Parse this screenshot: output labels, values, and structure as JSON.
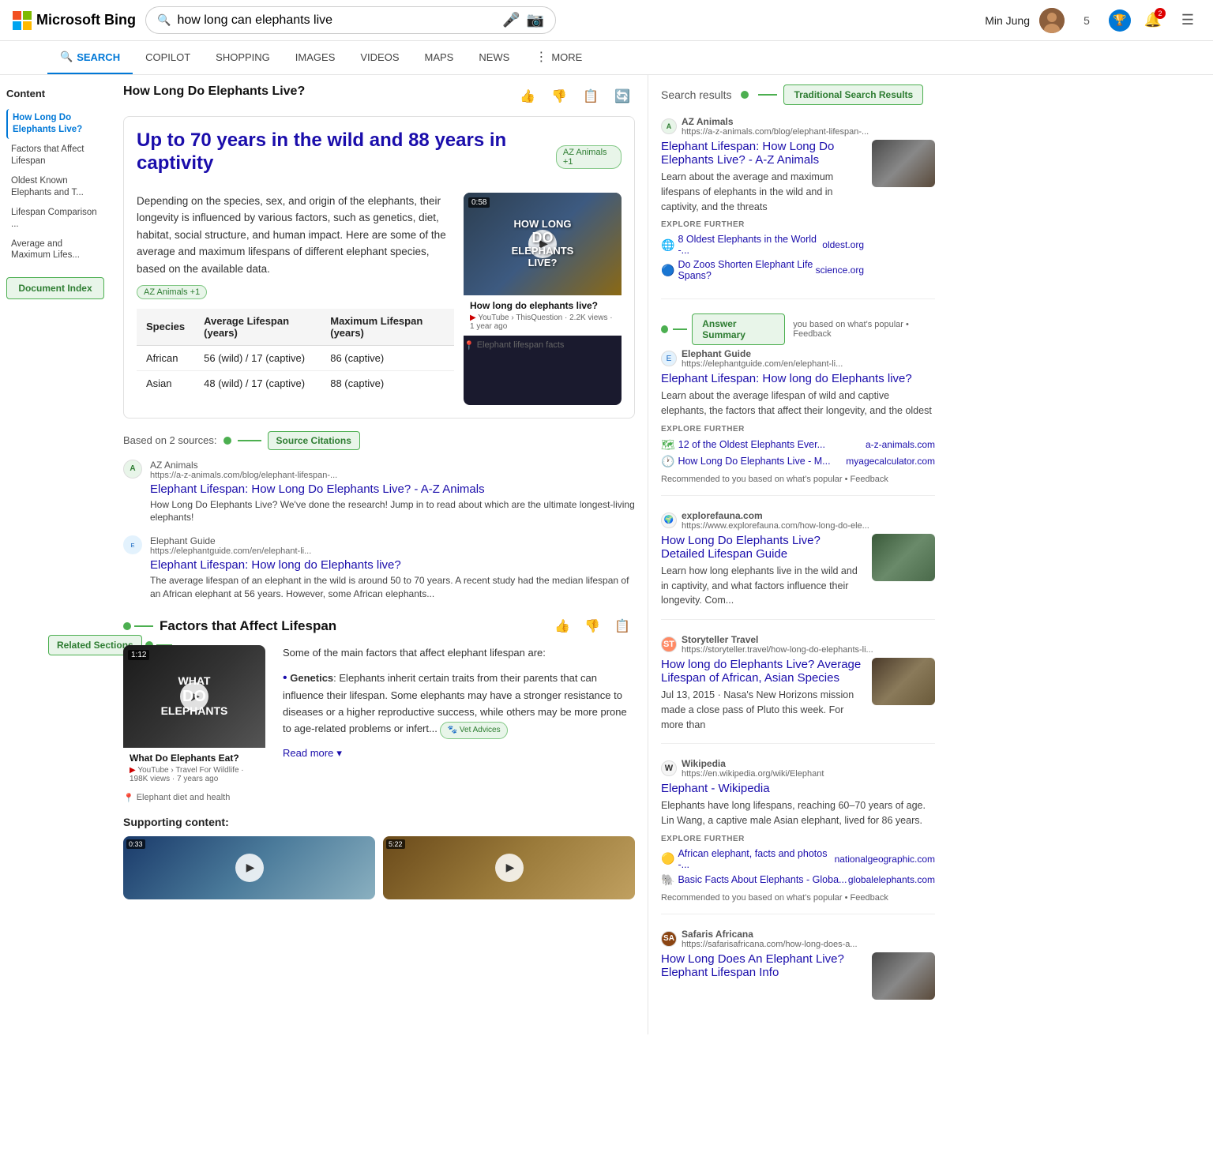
{
  "header": {
    "logo": "Microsoft Bing",
    "search_query": "how long can elephants live",
    "user_name": "Min Jung",
    "notifications_count": "2",
    "nav_tabs": [
      {
        "label": "SEARCH",
        "icon": "🔍",
        "active": true
      },
      {
        "label": "COPILOT",
        "active": false
      },
      {
        "label": "SHOPPING",
        "active": false
      },
      {
        "label": "IMAGES",
        "active": false
      },
      {
        "label": "VIDEOS",
        "active": false
      },
      {
        "label": "MAPS",
        "active": false
      },
      {
        "label": "NEWS",
        "active": false
      },
      {
        "label": "MORE",
        "active": false
      }
    ]
  },
  "sidebar": {
    "title": "Content",
    "items": [
      {
        "label": "How Long Do Elephants Live?",
        "active": true
      },
      {
        "label": "Factors that Affect Lifespan"
      },
      {
        "label": "Oldest Known Elephants and T..."
      },
      {
        "label": "Lifespan Comparison ..."
      },
      {
        "label": "Average and Maximum Lifes..."
      }
    ],
    "doc_index_label": "Document Index"
  },
  "main": {
    "page_title": "How Long Do Elephants Live?",
    "answer": {
      "headline": "Up to 70 years in the wild and 88 years in captivity",
      "source_tag": "AZ Animals +1",
      "text": "Depending on the species, sex, and origin of the elephants, their longevity is influenced by various factors, such as genetics, diet, habitat, social structure, and human impact. Here are some of the average and maximum lifespans of different elephant species, based on the available data.",
      "location_tag": "Elephant lifespan facts",
      "video": {
        "duration": "0:58",
        "title": "How long do elephants live?",
        "source": "YouTube › ThisQuestion · 2.2K views · 1 year ago",
        "text_overlay_line1": "HOW LONG",
        "text_overlay_line2": "DO",
        "text_overlay_line3": "ELEPHANTS",
        "text_overlay_line4": "LIVE?"
      },
      "table": {
        "headers": [
          "Species",
          "Average Lifespan (years)",
          "Maximum Lifespan (years)"
        ],
        "rows": [
          [
            "African",
            "56 (wild) / 17 (captive)",
            "86 (captive)"
          ],
          [
            "Asian",
            "48 (wild) / 17 (captive)",
            "88 (captive)"
          ]
        ]
      }
    },
    "sources": {
      "count_label": "Based on 2 sources:",
      "label": "Source Citations",
      "items": [
        {
          "name": "AZ Animals",
          "url": "https://a-z-animals.com/blog/elephant-lifespan-...",
          "link": "Elephant Lifespan: How Long Do Elephants Live? - A-Z Animals",
          "desc": "How Long Do Elephants Live? We've done the research! Jump in to read about which are the ultimate longest-living elephants!"
        },
        {
          "name": "Elephant Guide",
          "url": "https://elephantguide.com/en/elephant-li...",
          "link": "Elephant Lifespan: How long do Elephants live?",
          "desc": "The average lifespan of an elephant in the wild is around 50 to 70 years. A recent study had the median lifespan of an African elephant at 56 years. However, some African elephants..."
        }
      ]
    },
    "factors_section": {
      "title": "Factors that Affect Lifespan",
      "video": {
        "duration": "1:12",
        "title": "What Do Elephants Eat?",
        "source": "YouTube › Travel For Wildlife · 198K views · 7 years ago",
        "text_overlay_line1": "WHAT",
        "text_overlay_line2": "DO",
        "text_overlay_line3": "ELEPHANTS"
      },
      "location_tag": "Elephant diet and health",
      "intro": "Some of the main factors that affect elephant lifespan are:",
      "bullets": [
        {
          "term": "Genetics",
          "text": "Elephants inherit certain traits from their parents that can influence their lifespan. Some elephants may have a stronger resistance to diseases or a higher reproductive success, while others may be more prone to age-related problems or infert..."
        }
      ],
      "vet_badge": "Vet Advices",
      "read_more": "Read more",
      "supporting_content_label": "Supporting content:",
      "support_videos": [
        {
          "duration": "0:33"
        },
        {
          "duration": "5:22"
        }
      ]
    },
    "related_sections_label": "Related Sections"
  },
  "right_panel": {
    "search_results_label": "Search results",
    "traditional_tag": "Traditional Search Results",
    "answer_summary_tag": "Answer Summary",
    "results": [
      {
        "domain": "AZ Animals",
        "url": "https://a-z-animals.com/blog/elephant-lifespan-...",
        "title": "Elephant Lifespan: How Long Do Elephants Live? - A-Z Animals",
        "desc": "Learn about the average and maximum lifespans of elephants in the wild and in captivity, and the threats",
        "explore": [
          {
            "text": "8 Oldest Elephants in the World -...",
            "domain": "oldest.org"
          },
          {
            "text": "Do Zoos Shorten Elephant Life Spans?",
            "domain": "science.org"
          }
        ],
        "has_thumb": true,
        "thumb_class": "thumb-elephant1"
      },
      {
        "domain": "Elephant Guide",
        "url": "https://elephantguide.com/en/elephant-li...",
        "title": "Elephant Lifespan: How long do Elephants live?",
        "desc": "Learn about the average lifespan of wild and captive elephants, the factors that affect their longevity, and the oldest",
        "explore": [
          {
            "text": "12 of the Oldest Elephants Ever...",
            "domain": "a-z-animals.com"
          },
          {
            "text": "How Long Do Elephants Live - M...",
            "domain": "myagecalculator.com"
          }
        ],
        "recommended": "Recommended to you based on what's popular • Feedback",
        "has_thumb": false
      },
      {
        "domain": "explorefauna.com",
        "url": "https://www.explorefauna.com/how-long-do-ele...",
        "title": "How Long Do Elephants Live? Detailed Lifespan Guide",
        "desc": "Learn how long elephants live in the wild and in captivity, and what factors influence their longevity. Com...",
        "has_thumb": true,
        "thumb_class": "thumb-elephant2"
      },
      {
        "domain": "Storyteller Travel",
        "url": "https://storyteller.travel/how-long-do-elephants-li...",
        "title": "How long do Elephants Live? Average Lifespan of African, Asian Species",
        "desc": "Jul 13, 2015 · Nasa's New Horizons mission made a close pass of Pluto this week. For more than",
        "has_thumb": true,
        "thumb_class": "thumb-elephant3"
      },
      {
        "domain": "Wikipedia",
        "url": "https://en.wikipedia.org/wiki/Elephant",
        "title": "Elephant - Wikipedia",
        "desc": "Elephants have long lifespans, reaching 60–70 years of age. Lin Wang, a captive male Asian elephant, lived for 86 years.",
        "explore": [
          {
            "text": "African elephant, facts and photos -...",
            "domain": "nationalgeographic.com"
          },
          {
            "text": "Basic Facts About Elephants - Globa...",
            "domain": "globalelephants.com"
          }
        ],
        "recommended": "Recommended to you based on what's popular • Feedback",
        "has_thumb": false
      },
      {
        "domain": "Safaris Africana",
        "url": "https://safarisafricana.com/how-long-does-a...",
        "title": "How Long Does An Elephant Live? Elephant Lifespan Info",
        "desc": "",
        "has_thumb": true,
        "thumb_class": "thumb-elephant3"
      }
    ]
  }
}
